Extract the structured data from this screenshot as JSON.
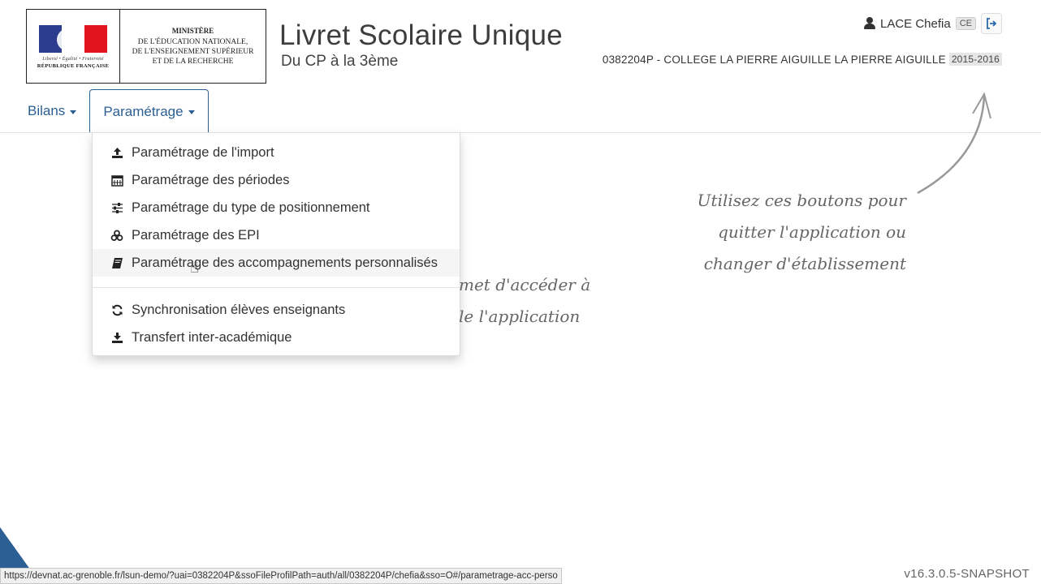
{
  "logo": {
    "motto": "Liberté • Égalité • Fraternité",
    "republique": "RÉPUBLIQUE FRANÇAISE",
    "ministere": [
      "MINISTÈRE",
      "DE L'ÉDUCATION NATIONALE,",
      "DE L'ENSEIGNEMENT SUPÉRIEUR",
      "ET DE LA RECHERCHE"
    ]
  },
  "header": {
    "title": "Livret Scolaire Unique",
    "subtitle": "Du CP à la 3ème",
    "user_name": "LACE Chefia",
    "role": "CE",
    "etablissement": "0382204P - COLLEGE LA PIERRE AIGUILLE LA PIERRE AIGUILLE",
    "annee": "2015-2016"
  },
  "nav": {
    "bilans": "Bilans",
    "parametrage": "Paramétrage"
  },
  "dropdown": {
    "items": [
      {
        "label": "Paramétrage de l'import",
        "icon": "upload-icon"
      },
      {
        "label": "Paramétrage des périodes",
        "icon": "calendar-icon"
      },
      {
        "label": "Paramétrage du type de positionnement",
        "icon": "sliders-icon"
      },
      {
        "label": "Paramétrage des EPI",
        "icon": "cubes-icon"
      },
      {
        "label": "Paramétrage des accompagnements personnalisés",
        "icon": "book-icon"
      }
    ],
    "items2": [
      {
        "label": "Synchronisation élèves enseignants",
        "icon": "refresh-icon"
      },
      {
        "label": "Transfert inter-académique",
        "icon": "download-icon"
      }
    ]
  },
  "annotations": {
    "right": [
      "Utilisez ces boutons pour",
      "quitter l'application ou",
      "changer d'établissement"
    ],
    "center": [
      "met d'accéder à",
      "le l'application"
    ]
  },
  "status_url": "https://devnat.ac-grenoble.fr/lsun-demo/?uai=0382204P&ssoFileProfilPath=auth/all/0382204P/chefia&sso=O#/parametrage-acc-perso",
  "version": "v16.3.0.5-SNAPSHOT"
}
